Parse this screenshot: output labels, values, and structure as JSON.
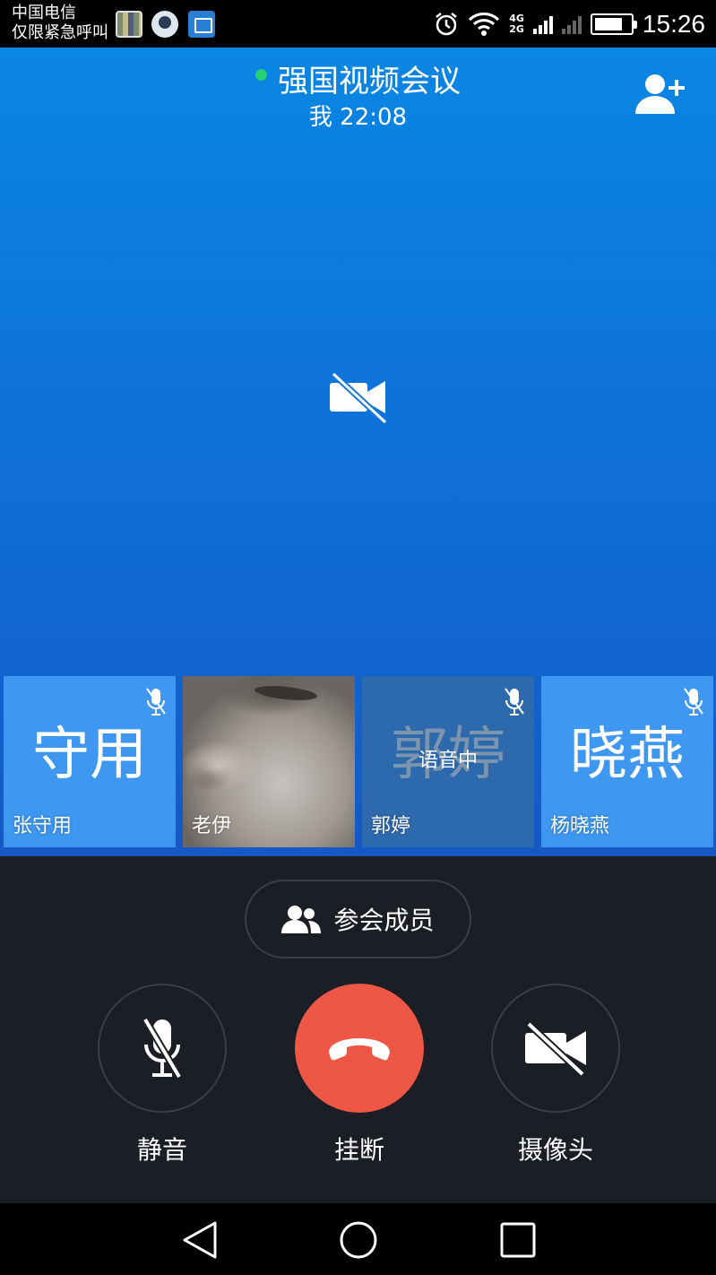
{
  "status_bar": {
    "carrier_line1": "中国电信",
    "carrier_line2": "仅限紧急呼叫",
    "network_4g": "4G",
    "network_2g": "2G",
    "time": "15:26",
    "icons": [
      "alarm-icon",
      "wifi-icon",
      "signal-icon",
      "battery-icon"
    ]
  },
  "header": {
    "title": "强国视频会议",
    "subtitle": "我 22:08",
    "status_color": "#25d071"
  },
  "participants": [
    {
      "big_label": "守用",
      "name": "张守用",
      "muted": true,
      "video": false
    },
    {
      "big_label": "",
      "name": "老伊",
      "muted": false,
      "video": true
    },
    {
      "big_label": "郭婷",
      "name": "郭婷",
      "overlay": "语音中",
      "muted": true,
      "video": false
    },
    {
      "big_label": "晓燕",
      "name": "杨晓燕",
      "muted": true,
      "video": false
    }
  ],
  "controls": {
    "members_label": "参会成员",
    "mute_label": "静音",
    "hangup_label": "挂断",
    "camera_label": "摄像头",
    "hangup_color": "#ee5645"
  },
  "nav": {
    "icons": [
      "back-icon",
      "home-icon",
      "recent-apps-icon"
    ]
  }
}
